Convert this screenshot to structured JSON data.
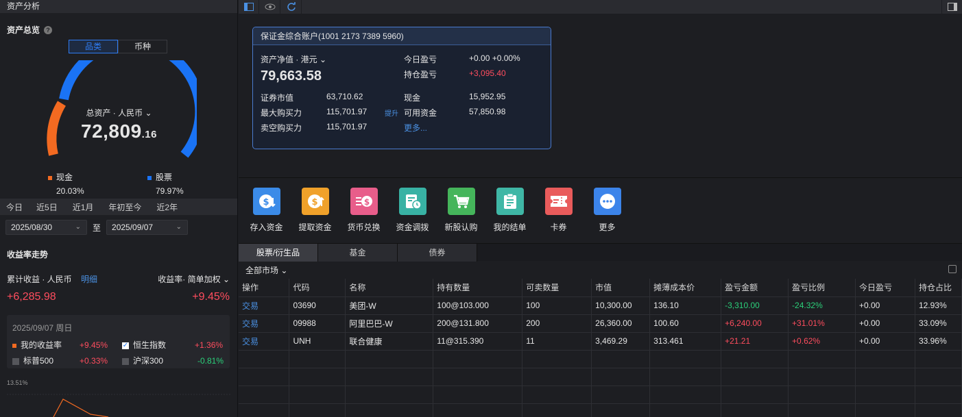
{
  "left": {
    "header": "资产分析",
    "overview_title": "资产总览",
    "seg": [
      "品类",
      "币种"
    ],
    "total_label": "总资产 · 人民币",
    "total_int": "72,809",
    "total_dec": ".16",
    "cash_label": "现金",
    "cash_pct": "20.03%",
    "stock_label": "股票",
    "stock_pct": "79.97%",
    "ranges": [
      "今日",
      "近5日",
      "近1月",
      "年初至今",
      "近2年"
    ],
    "date_from": "2025/08/30",
    "date_to_label": "至",
    "date_to": "2025/09/07",
    "trend_title": "收益率走势",
    "cum_label": "累计收益 · 人民币",
    "detail_link": "明细",
    "rate_label": "收益率· 简单加权",
    "cum_value": "+6,285.98",
    "cum_rate": "+9.45%",
    "compare": {
      "date": "2025/09/07 周日",
      "items": [
        {
          "name": "我的收益率",
          "value": "+9.45%"
        },
        {
          "name": "恒生指数",
          "value": "+1.36%"
        },
        {
          "name": "标普500",
          "value": "+0.33%"
        },
        {
          "name": "沪深300",
          "value": "-0.81%"
        }
      ]
    },
    "mini_axis_top": "13.51%",
    "colors": {
      "cash": "#f36a21",
      "stock": "#1a73f5"
    }
  },
  "account": {
    "title": "保证金综合账户(1001 2173 7389 5960)",
    "net_label": "资产净值 · 港元",
    "net_value": "79,663.58",
    "today_pl_label": "今日盈亏",
    "today_pl": "+0.00 +0.00%",
    "hold_pl_label": "持仓盈亏",
    "hold_pl": "+3,095.40",
    "sec_value_label": "证券市值",
    "sec_value": "63,710.62",
    "cash_label": "现金",
    "cash": "15,952.95",
    "max_buy_label": "最大购买力",
    "max_buy": "115,701.97",
    "raise_label": "提升",
    "avail_label": "可用资金",
    "avail": "57,850.98",
    "short_label": "卖空购买力",
    "short_value": "115,701.97",
    "more_label": "更多..."
  },
  "actions": [
    {
      "label": "存入资金",
      "icon": "deposit-icon",
      "color": "#3b8be8"
    },
    {
      "label": "提取资金",
      "icon": "withdraw-icon",
      "color": "#f0a12a"
    },
    {
      "label": "货币兑换",
      "icon": "exchange-icon",
      "color": "#e85d8a"
    },
    {
      "label": "资金调拨",
      "icon": "transfer-icon",
      "color": "#38b2a4"
    },
    {
      "label": "新股认购",
      "icon": "ipo-icon",
      "color": "#45b55b"
    },
    {
      "label": "我的结单",
      "icon": "statement-icon",
      "color": "#3fb7a6"
    },
    {
      "label": "卡券",
      "icon": "coupon-icon",
      "color": "#e95b5b"
    },
    {
      "label": "更多",
      "icon": "more-icon",
      "color": "#3c84ea"
    }
  ],
  "tabs": [
    "股票/衍生品",
    "基金",
    "债券"
  ],
  "market_filter": "全部市场",
  "table": {
    "headers": [
      "操作",
      "代码",
      "名称",
      "持有数量",
      "可卖数量",
      "市值",
      "摊薄成本价",
      "盈亏金额",
      "盈亏比例",
      "今日盈亏",
      "持仓占比"
    ],
    "rows": [
      [
        "交易",
        "03690",
        "美团-W",
        "100@103.000",
        "100",
        "10,300.00",
        "136.10",
        "-3,310.00",
        "-24.32%",
        "+0.00",
        "12.93%"
      ],
      [
        "交易",
        "09988",
        "阿里巴巴-W",
        "200@131.800",
        "200",
        "26,360.00",
        "100.60",
        "+6,240.00",
        "+31.01%",
        "+0.00",
        "33.09%"
      ],
      [
        "交易",
        "UNH",
        "联合健康",
        "11@315.390",
        "11",
        "3,469.29",
        "313.461",
        "+21.21",
        "+0.62%",
        "+0.00",
        "33.96%"
      ]
    ]
  }
}
